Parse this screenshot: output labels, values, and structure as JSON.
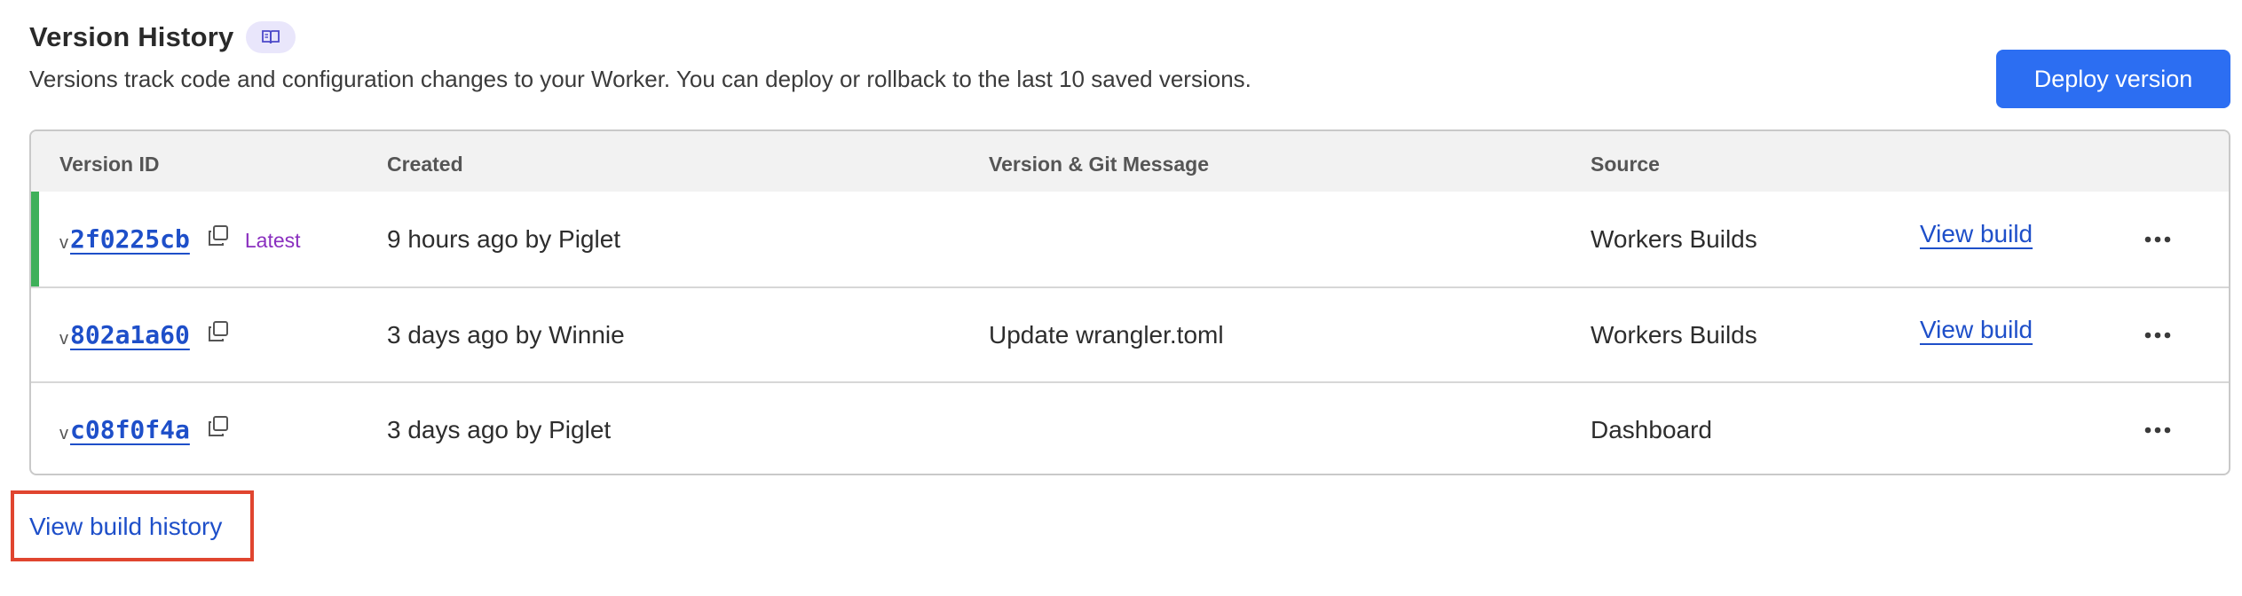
{
  "header": {
    "title": "Version History",
    "docs_icon": "book-icon",
    "subtitle": "Versions track code and configuration changes to your Worker. You can deploy or rollback to the last 10 saved versions.",
    "deploy_button": "Deploy version"
  },
  "table": {
    "columns": [
      "Version ID",
      "Created",
      "Version & Git Message",
      "Source"
    ],
    "rows": [
      {
        "prefix": "v",
        "version_id": "2f0225cb",
        "latest": "Latest",
        "created": "9 hours ago by Piglet",
        "message": "",
        "source": "Workers Builds",
        "action": "View build"
      },
      {
        "prefix": "v",
        "version_id": "802a1a60",
        "latest": "",
        "created": "3 days ago by Winnie",
        "message": "Update wrangler.toml",
        "source": "Workers Builds",
        "action": "View build"
      },
      {
        "prefix": "v",
        "version_id": "c08f0f4a",
        "latest": "",
        "created": "3 days ago by Piglet",
        "message": "",
        "source": "Dashboard",
        "action": ""
      }
    ]
  },
  "footer": {
    "history_link": "View build history"
  },
  "colors": {
    "accent": "#2c6ef2",
    "link": "#1e4fc9",
    "latest_bar": "#3fb05a",
    "latest_text": "#8a2fbf",
    "highlight": "#e0452f"
  }
}
